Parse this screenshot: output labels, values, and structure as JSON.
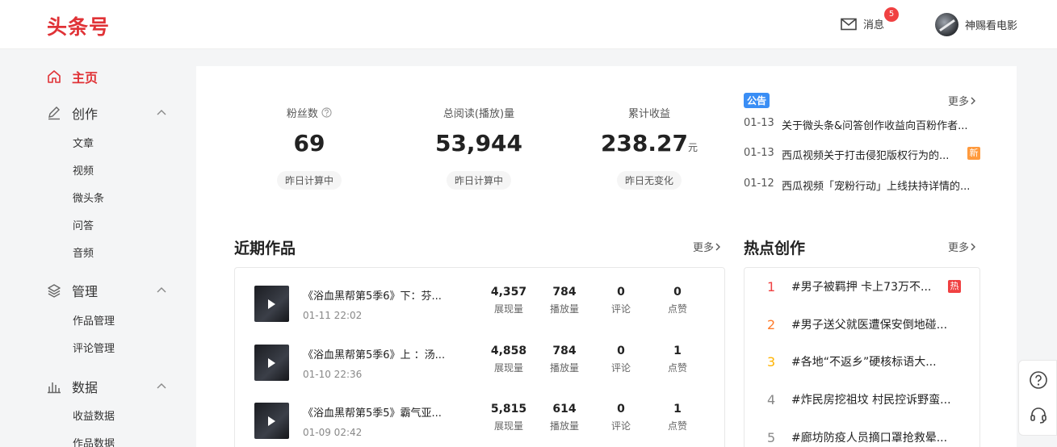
{
  "header": {
    "logo": "头条号",
    "messages_label": "消息",
    "messages_count": "5",
    "username": "神赐看电影"
  },
  "sidebar": {
    "home": "主页",
    "sections": [
      {
        "label": "创作",
        "items": [
          "文章",
          "视频",
          "微头条",
          "问答",
          "音频"
        ]
      },
      {
        "label": "管理",
        "items": [
          "作品管理",
          "评论管理"
        ]
      },
      {
        "label": "数据",
        "items": [
          "收益数据",
          "作品数据"
        ]
      }
    ]
  },
  "stats": [
    {
      "label": "粉丝数",
      "value": "69",
      "unit": "",
      "note": "昨日计算中"
    },
    {
      "label": "总阅读(播放)量",
      "value": "53,944",
      "unit": "",
      "note": "昨日计算中"
    },
    {
      "label": "累计收益",
      "value": "238.27",
      "unit": "元",
      "note": "昨日无变化"
    }
  ],
  "announcements": {
    "tag": "公告",
    "more": "更多",
    "new_tag": "新",
    "items": [
      {
        "date": "01-13",
        "text": "关于微头条&问答创作收益向百粉作者..."
      },
      {
        "date": "01-13",
        "text": "西瓜视频关于打击侵犯版权行为的..."
      },
      {
        "date": "01-12",
        "text": "西瓜视频「宠粉行动」上线扶持详情的..."
      }
    ]
  },
  "recent_works": {
    "title": "近期作品",
    "more": "更多",
    "metric_labels": [
      "展现量",
      "播放量",
      "评论",
      "点赞"
    ],
    "items": [
      {
        "title": "《浴血黑帮第5季6》下：芬...",
        "time": "01-11 22:02",
        "metrics": [
          "4,357",
          "784",
          "0",
          "0"
        ]
      },
      {
        "title": "《浴血黑帮第5季6》上 ：汤...",
        "time": "01-10 22:36",
        "metrics": [
          "4,858",
          "784",
          "0",
          "1"
        ]
      },
      {
        "title": "《浴血黑帮第5季5》霸气亚...",
        "time": "01-09 02:42",
        "metrics": [
          "5,815",
          "614",
          "0",
          "1"
        ]
      }
    ]
  },
  "hot": {
    "title": "热点创作",
    "more": "更多",
    "hot_tag": "热",
    "rank_colors": [
      "#f04142",
      "#ff7a29",
      "#ffb300",
      "#888888",
      "#888888"
    ],
    "items": [
      {
        "rank": "1",
        "text": "#男子被羁押 卡上73万不..."
      },
      {
        "rank": "2",
        "text": "#男子送父就医遭保安倒地碰..."
      },
      {
        "rank": "3",
        "text": "#各地“不返乡”硬核标语大..."
      },
      {
        "rank": "4",
        "text": "#炸民房挖祖坟 村民控诉野蛮..."
      },
      {
        "rank": "5",
        "text": "#廊坊防疫人员摘口罩抢救晕..."
      }
    ]
  }
}
